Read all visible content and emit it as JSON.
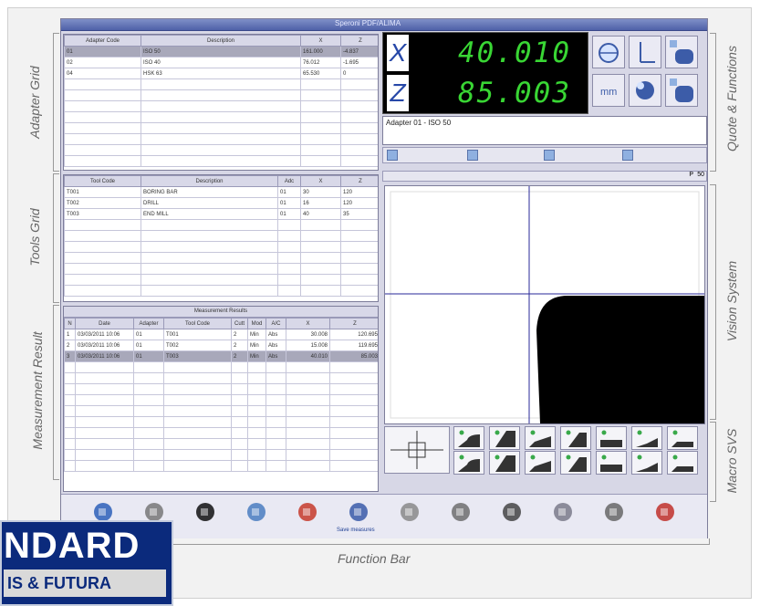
{
  "window": {
    "title": "Speroni PDF/ALIMA"
  },
  "labels": {
    "adapter_grid": "Adapter Grid",
    "tools_grid": "Tools Grid",
    "measurement_result": "Measurement Result",
    "quote_functions": "Quote & Functions",
    "vision_system": "Vision System",
    "macro_svs": "Macro SVS",
    "function_bar": "Function Bar"
  },
  "adapter_grid": {
    "columns": [
      "Adapter Code",
      "Description",
      "X",
      "Z"
    ],
    "rows": [
      [
        "01",
        "ISO 50",
        "161.000",
        "-4.837"
      ],
      [
        "02",
        "ISO 40",
        "76.012",
        "-1.695"
      ],
      [
        "04",
        "HSK 63",
        "65.530",
        "0"
      ]
    ]
  },
  "tools_grid": {
    "columns": [
      "Tool Code",
      "Description",
      "Adc",
      "X",
      "Z"
    ],
    "rows": [
      [
        "T001",
        "BORING BAR",
        "01",
        "30",
        "120"
      ],
      [
        "T002",
        "DRILL",
        "01",
        "16",
        "120"
      ],
      [
        "T003",
        "END MILL",
        "01",
        "40",
        "35"
      ]
    ]
  },
  "measurement_result": {
    "title": "Measurement Results",
    "columns": [
      "N",
      "Date",
      "Adapter",
      "Tool Code",
      "Cutt",
      "Mod",
      "A/C",
      "X",
      "Z"
    ],
    "rows": [
      [
        "1",
        "03/03/2011 10:06",
        "01",
        "T001",
        "2",
        "Min",
        "Abs",
        "30.008",
        "120.695"
      ],
      [
        "2",
        "03/03/2011 10:06",
        "01",
        "T002",
        "2",
        "Min",
        "Abs",
        "15.008",
        "119.695"
      ],
      [
        "3",
        "03/03/2011 10:06",
        "01",
        "T003",
        "2",
        "Min",
        "Abs",
        "40.010",
        "85.003"
      ]
    ]
  },
  "readout": {
    "x_axis": "X",
    "z_axis": "Z",
    "x_value": "40.010",
    "z_value": "85.003",
    "adapter_info": "Adapter 01 - ISO 50",
    "unit_button": "mm"
  },
  "vision": {
    "mode_p": "P",
    "mode_50": "50"
  },
  "function_bar": {
    "hint": "Save measures"
  },
  "logo": {
    "line1": "NDARD",
    "line2": "IS & FUTURA"
  },
  "colors": {
    "readout_digits": "#39d634",
    "axis_letters": "#2748a8",
    "titlebar": "#4f61a8"
  }
}
